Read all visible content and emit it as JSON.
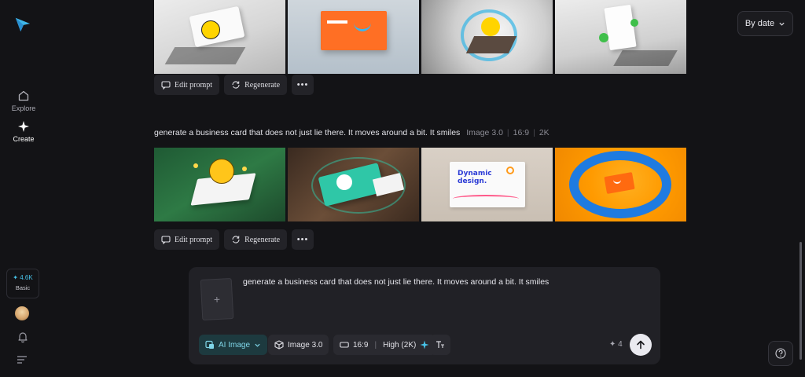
{
  "sidebar": {
    "logo_icon": "paper-plane-logo-icon",
    "items": [
      {
        "label": "Explore",
        "icon": "home-icon"
      },
      {
        "label": "Create",
        "icon": "sparkle-icon"
      }
    ],
    "credits": {
      "amount": "✦ 4.6K",
      "plan": "Basic"
    },
    "avatar_icon": "user-avatar",
    "bell_icon": "bell-icon",
    "menu_icon": "menu-icon"
  },
  "sort": {
    "label": "By date",
    "icon": "chevron-down-icon"
  },
  "generations": [
    {
      "prompt": "",
      "actions": {
        "edit": "Edit prompt",
        "regenerate": "Regenerate",
        "more": "•••"
      }
    },
    {
      "prompt": "generate a business card that does not just lie there. It moves around a bit. It smiles",
      "model": "Image 3.0",
      "ratio": "16:9",
      "resolution": "2K",
      "image_texts": [
        "Dynamic design."
      ],
      "actions": {
        "edit": "Edit prompt",
        "regenerate": "Regenerate",
        "more": "•••"
      }
    }
  ],
  "composer": {
    "add_reference": "+",
    "text": "generate a business card that does not just lie there. It moves around a bit. It smiles",
    "mode": "AI Image",
    "model": "Image 3.0",
    "ratio": "16:9",
    "quality": "High (2K)",
    "cost": "✦ 4"
  },
  "colors": {
    "accent": "#47c3e8",
    "background": "#131316",
    "panel": "#212126"
  }
}
